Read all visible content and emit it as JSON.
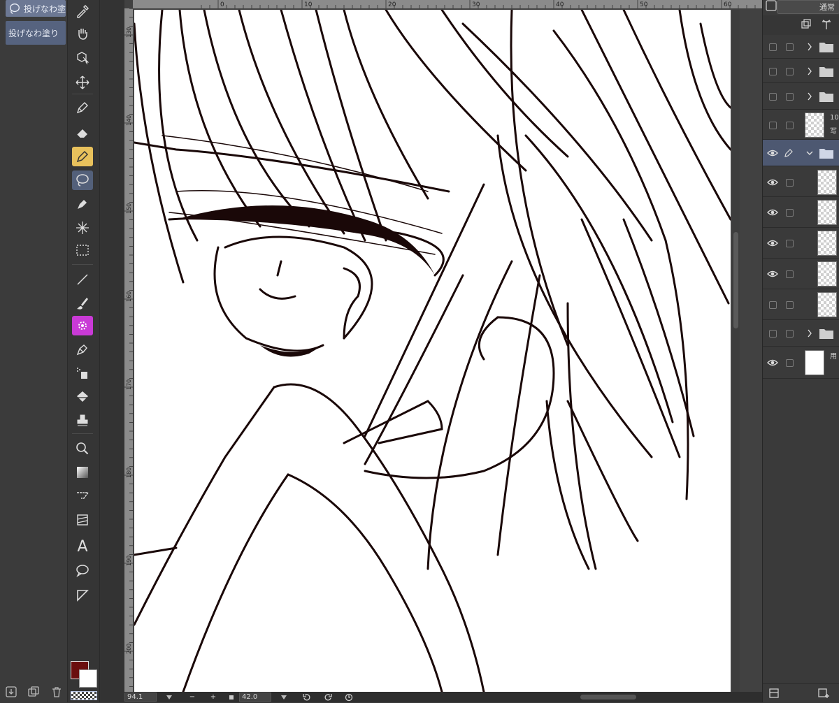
{
  "subtools": {
    "active_label": "投げなわ塗",
    "item_label": "投げなわ塗り"
  },
  "tools": [
    {
      "id": "eyedropper",
      "icon": "eyedropper-icon"
    },
    {
      "id": "hand",
      "icon": "hand-icon"
    },
    {
      "id": "object",
      "icon": "object-select-icon"
    },
    {
      "id": "move",
      "icon": "move-icon"
    },
    {
      "id": "pen",
      "icon": "pen-icon"
    },
    {
      "id": "eraser",
      "icon": "eraser-icon"
    },
    {
      "id": "marker",
      "icon": "marker-pen-icon"
    },
    {
      "id": "lasso-fill",
      "icon": "lasso-fill-icon"
    },
    {
      "id": "pencil",
      "icon": "pencil-icon"
    },
    {
      "id": "sparkle",
      "icon": "sparkle-icon"
    },
    {
      "id": "selection",
      "icon": "rect-selection-icon"
    },
    {
      "id": "line",
      "icon": "line-icon"
    },
    {
      "id": "brush",
      "icon": "brush-icon"
    },
    {
      "id": "decoration",
      "icon": "decoration-icon"
    },
    {
      "id": "pen2",
      "icon": "fountain-pen-icon"
    },
    {
      "id": "spray",
      "icon": "airbrush-icon"
    },
    {
      "id": "fill",
      "icon": "paint-bucket-icon"
    },
    {
      "id": "stamp",
      "icon": "stamp-icon"
    },
    {
      "id": "zoom",
      "icon": "zoom-icon"
    },
    {
      "id": "gradient",
      "icon": "gradient-icon"
    },
    {
      "id": "ruler",
      "icon": "ruler-icon"
    },
    {
      "id": "frame",
      "icon": "frame-border-icon"
    },
    {
      "id": "text",
      "icon": "text-icon",
      "glyph": "A"
    },
    {
      "id": "balloon",
      "icon": "speech-balloon-icon"
    },
    {
      "id": "correct",
      "icon": "correct-line-icon"
    }
  ],
  "ruler": {
    "top_ticks": [
      "0",
      "10",
      "20",
      "30",
      "40",
      "50",
      "60"
    ],
    "left_ticks": [
      "130",
      "140",
      "150",
      "160",
      "170",
      "180",
      "190",
      "200"
    ]
  },
  "status": {
    "zoom": "94.1",
    "minus": "−",
    "plus": "+",
    "angle": "42.0"
  },
  "layers": {
    "blend_mode": "通常",
    "rows": [
      {
        "kind": "folder",
        "visible": false,
        "selected": false
      },
      {
        "kind": "folder",
        "visible": false,
        "selected": false
      },
      {
        "kind": "folder",
        "visible": false,
        "selected": false
      },
      {
        "kind": "raster",
        "visible": false,
        "selected": false,
        "line1": "10",
        "line2": "写"
      },
      {
        "kind": "folder-open",
        "visible": true,
        "selected": true
      },
      {
        "kind": "raster",
        "visible": true,
        "selected": false
      },
      {
        "kind": "raster",
        "visible": true,
        "selected": false
      },
      {
        "kind": "raster",
        "visible": true,
        "selected": false
      },
      {
        "kind": "raster",
        "visible": true,
        "selected": false
      },
      {
        "kind": "raster",
        "visible": false,
        "selected": false
      },
      {
        "kind": "folder",
        "visible": false,
        "selected": false
      },
      {
        "kind": "paper",
        "visible": true,
        "selected": false,
        "line1": "用"
      }
    ]
  },
  "colors": {
    "main": "#6a0e0e",
    "sub": "#ffffff",
    "active_tool_bg": "#53607a",
    "selected_layer_bg": "#4d5871"
  }
}
